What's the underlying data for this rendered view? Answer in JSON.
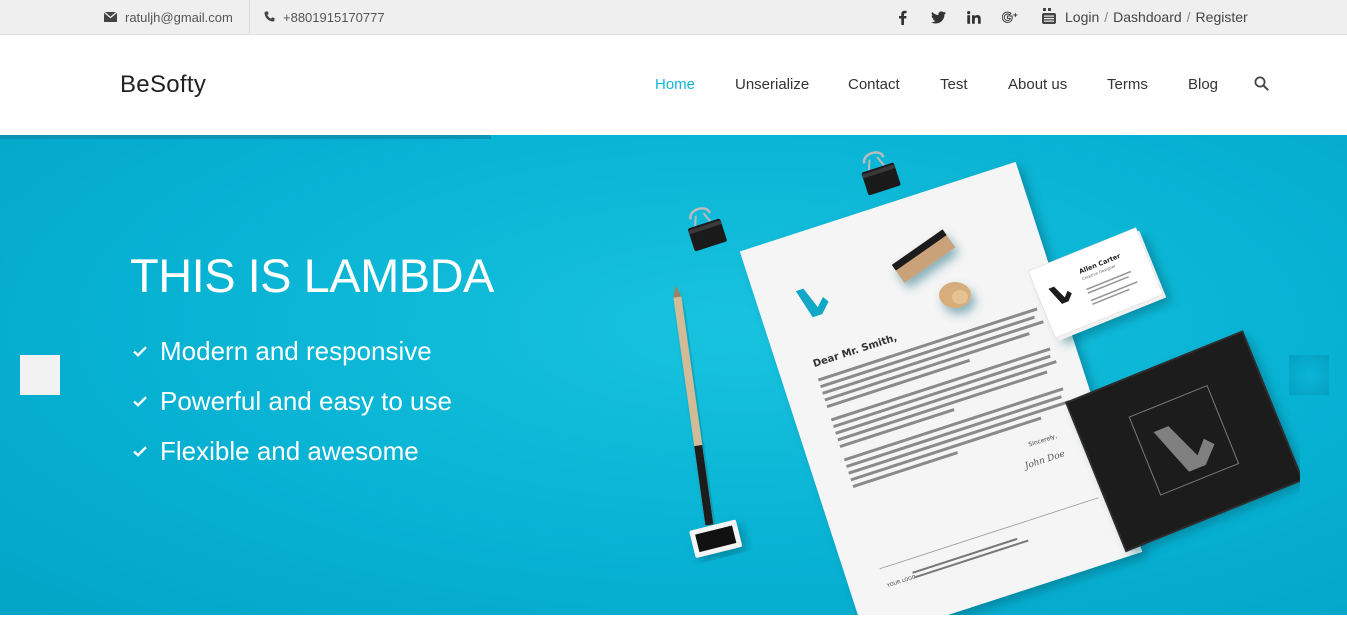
{
  "topbar": {
    "email": "ratuljh@gmail.com",
    "phone": "+8801915170777",
    "social_icons": [
      "facebook-icon",
      "twitter-icon",
      "linkedin-icon",
      "google-plus-icon"
    ],
    "account": {
      "login": "Login",
      "separator": "/",
      "dashboard": "Dashdoard",
      "register": "Register"
    }
  },
  "navbar": {
    "brand": "BeSofty",
    "menu": [
      {
        "label": "Home",
        "active": true
      },
      {
        "label": "Unserialize"
      },
      {
        "label": "Contact"
      },
      {
        "label": "Test"
      },
      {
        "label": "About us"
      },
      {
        "label": "Terms"
      },
      {
        "label": "Blog"
      }
    ]
  },
  "hero": {
    "title": "THIS IS LAMBDA",
    "features": [
      "Modern and responsive",
      "Powerful and easy to use",
      "Flexible and awesome"
    ],
    "accent_color": "#07b2d3",
    "mockup": {
      "letter_greeting": "Dear Mr. Smith,",
      "letter_closing": "Sincerely,",
      "letter_signature": "John Doe",
      "card_name": "Allen Carter",
      "card_title": "Creative Designer",
      "footer_logo": "YOUR LOGO"
    }
  }
}
